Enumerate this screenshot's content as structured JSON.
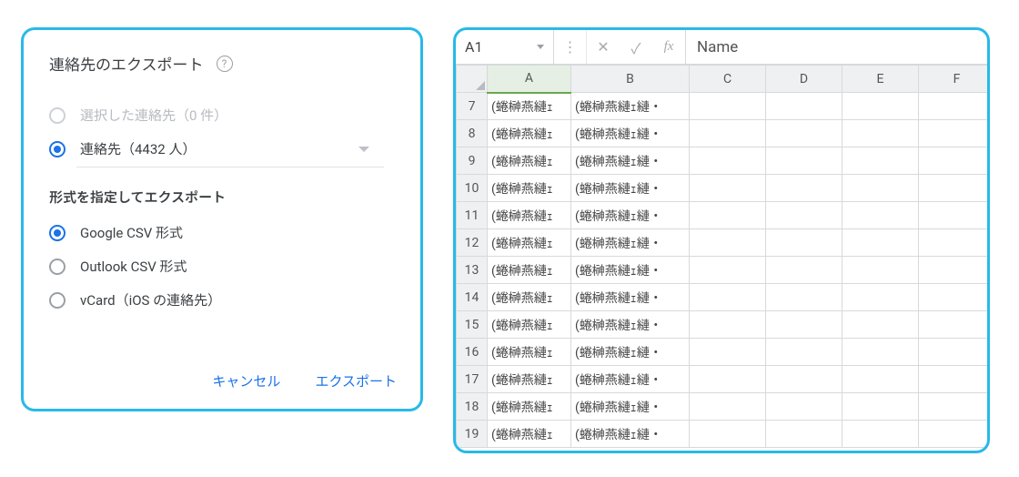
{
  "dialog": {
    "title": "連絡先のエクスポート",
    "help_icon_char": "?",
    "source_options": [
      {
        "key": "selected",
        "label": "選択した連絡先（0 件）",
        "checked": false,
        "disabled": true
      },
      {
        "key": "all",
        "label": "連絡先（4432 人）",
        "checked": true,
        "disabled": false
      }
    ],
    "format_heading": "形式を指定してエクスポート",
    "format_options": [
      {
        "key": "google",
        "label": "Google CSV 形式",
        "checked": true
      },
      {
        "key": "outlook",
        "label": "Outlook CSV 形式",
        "checked": false
      },
      {
        "key": "vcard",
        "label": "vCard（iOS の連絡先）",
        "checked": false
      }
    ],
    "buttons": {
      "cancel": "キャンセル",
      "export": "エクスポート"
    }
  },
  "sheet": {
    "name_box": "A1",
    "fx_label": "fx",
    "formula_value": "Name",
    "close_icon_char": "✕",
    "check_icon_char": "✓",
    "dots_icon_char": "⋮",
    "columns": [
      "A",
      "B",
      "C",
      "D",
      "E",
      "F"
    ],
    "selected_column_index": 0,
    "row_numbers": [
      7,
      8,
      9,
      10,
      11,
      12,
      13,
      14,
      15,
      16,
      17,
      18,
      19
    ],
    "cell_text": {
      "A": "(蜷榊燕縺ｪ",
      "B": "(蜷榊燕縺ｪ縺・"
    },
    "chart_data": null
  }
}
